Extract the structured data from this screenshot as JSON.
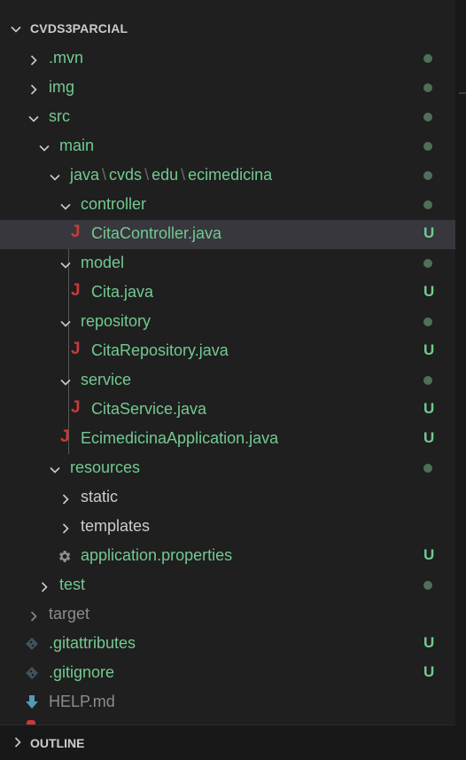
{
  "explorer": {
    "root_title": "CVDS3PARCIAL",
    "items": [
      {
        "label": "java",
        "path_parts": [
          "java",
          "cvds",
          "edu",
          "ecimedicina"
        ]
      }
    ],
    "rows": {
      "mvn": ".mvn",
      "img": "img",
      "src": "src",
      "main": "main",
      "java": "java",
      "cvds": "cvds",
      "edu": "edu",
      "ecimedicina": "ecimedicina",
      "path_separator": "\\",
      "controller": "controller",
      "cita_controller": "CitaController.java",
      "model": "model",
      "cita": "Cita.java",
      "repository": "repository",
      "cita_repository": "CitaRepository.java",
      "service": "service",
      "cita_service": "CitaService.java",
      "app": "EcimedicinaApplication.java",
      "resources": "resources",
      "static": "static",
      "templates": "templates",
      "app_properties": "application.properties",
      "test": "test",
      "target": "target",
      "gitattributes": ".gitattributes",
      "gitignore": ".gitignore",
      "help": "HELP.md"
    },
    "status_untracked": "U",
    "java_icon": "J",
    "colors": {
      "untracked_green": "#73c991",
      "dot_green": "#4e6f59",
      "java_red": "#c93a3a",
      "selected_bg": "#37373d"
    },
    "icons": {
      "folder_collapsed": "chevron-right-icon",
      "folder_expanded": "chevron-down-icon",
      "java_file": "java-icon",
      "settings_file": "gear-icon",
      "git_file": "git-icon",
      "markdown_file": "download-arrow-icon"
    }
  },
  "outline": {
    "title": "OUTLINE"
  }
}
